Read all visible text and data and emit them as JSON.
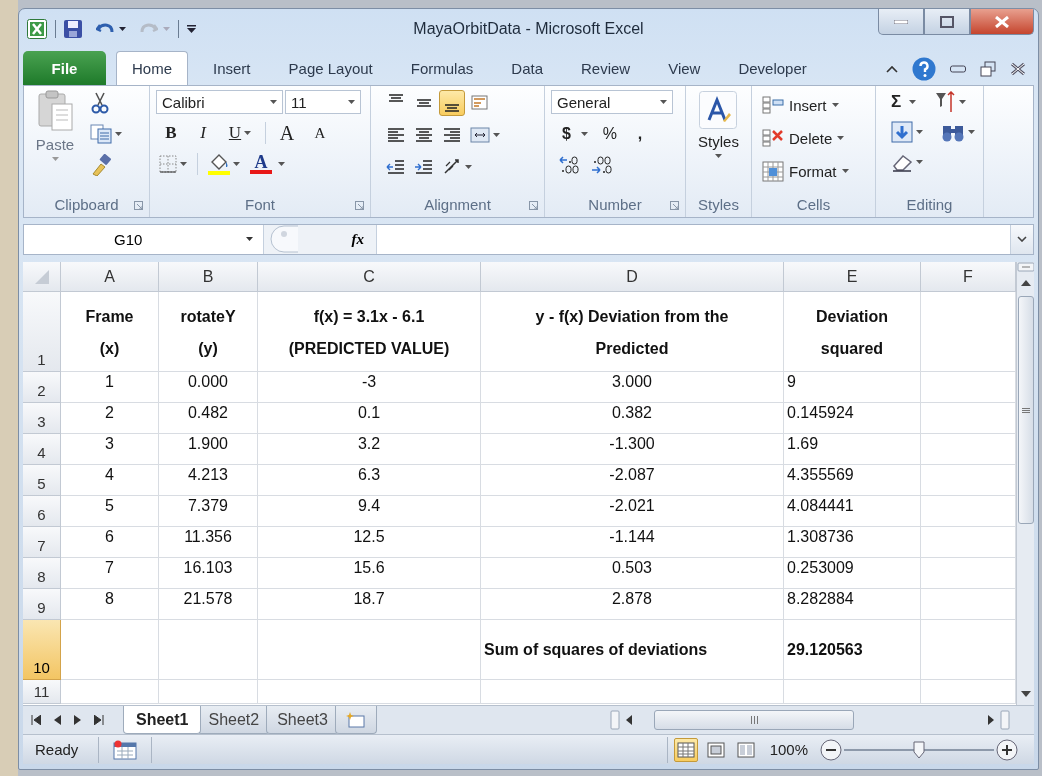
{
  "window": {
    "title": "MayaOrbitData - Microsoft Excel"
  },
  "ribbon_tabs": [
    {
      "label": "File",
      "kind": "file",
      "selected": false
    },
    {
      "label": "Home",
      "kind": "tab",
      "selected": true
    },
    {
      "label": "Insert",
      "kind": "tab",
      "selected": false
    },
    {
      "label": "Page Layout",
      "kind": "tab",
      "selected": false
    },
    {
      "label": "Formulas",
      "kind": "tab",
      "selected": false
    },
    {
      "label": "Data",
      "kind": "tab",
      "selected": false
    },
    {
      "label": "Review",
      "kind": "tab",
      "selected": false
    },
    {
      "label": "View",
      "kind": "tab",
      "selected": false
    },
    {
      "label": "Developer",
      "kind": "tab",
      "selected": false
    }
  ],
  "ribbon": {
    "clipboard": {
      "label": "Clipboard",
      "paste": "Paste"
    },
    "font": {
      "label": "Font",
      "name": "Calibri",
      "size": "11",
      "bold": "B",
      "italic": "I",
      "underline": "U",
      "grow": "A",
      "shrink": "A",
      "color_letter": "A"
    },
    "alignment": {
      "label": "Alignment",
      "buttons": [
        {
          "kind": "top",
          "selected": false
        },
        {
          "kind": "middle",
          "selected": false
        },
        {
          "kind": "bottom",
          "selected": true
        },
        {
          "kind": "wrap",
          "selected": false
        },
        {
          "kind": "left",
          "selected": false
        },
        {
          "kind": "center",
          "selected": false
        },
        {
          "kind": "right",
          "selected": false
        },
        {
          "kind": "merge",
          "selected": false
        },
        {
          "kind": "outdent",
          "selected": false
        },
        {
          "kind": "indent",
          "selected": false
        },
        {
          "kind": "orientation",
          "selected": false
        }
      ]
    },
    "number": {
      "label": "Number",
      "format": "General",
      "currency": "$",
      "percent": "%",
      "comma": ","
    },
    "styles": {
      "button": "Styles",
      "label": "Styles"
    },
    "cells": {
      "label": "Cells",
      "items": [
        "Insert",
        "Delete",
        "Format"
      ]
    },
    "editing": {
      "label": "Editing",
      "sum": "Σ"
    }
  },
  "formula_bar": {
    "name_box": "G10",
    "fx": "fx"
  },
  "sheet": {
    "columns": [
      {
        "label": "A",
        "selected": false
      },
      {
        "label": "B",
        "selected": false
      },
      {
        "label": "C",
        "selected": false
      },
      {
        "label": "D",
        "selected": false
      },
      {
        "label": "E",
        "selected": false
      },
      {
        "label": "F",
        "selected": false
      }
    ],
    "rows": [
      {
        "header": "1",
        "selected": false,
        "kind": "header",
        "cells": [
          "Frame\n(x)",
          "rotateY\n(y)",
          "f(x) = 3.1x - 6.1\n(PREDICTED VALUE)",
          "y - f(x) Deviation from the\nPredicted",
          "Deviation\nsquared"
        ]
      },
      {
        "header": "2",
        "selected": false,
        "kind": "data",
        "cells": [
          "1",
          "0.000",
          "-3",
          "3.000",
          "9"
        ]
      },
      {
        "header": "3",
        "selected": false,
        "kind": "data",
        "cells": [
          "2",
          "0.482",
          "0.1",
          "0.382",
          "0.145924"
        ]
      },
      {
        "header": "4",
        "selected": false,
        "kind": "data",
        "cells": [
          "3",
          "1.900",
          "3.2",
          "-1.300",
          "1.69"
        ]
      },
      {
        "header": "5",
        "selected": false,
        "kind": "data",
        "cells": [
          "4",
          "4.213",
          "6.3",
          "-2.087",
          "4.355569"
        ]
      },
      {
        "header": "6",
        "selected": false,
        "kind": "data",
        "cells": [
          "5",
          "7.379",
          "9.4",
          "-2.021",
          "4.084441"
        ]
      },
      {
        "header": "7",
        "selected": false,
        "kind": "data",
        "cells": [
          "6",
          "11.356",
          "12.5",
          "-1.144",
          "1.308736"
        ]
      },
      {
        "header": "8",
        "selected": false,
        "kind": "data",
        "cells": [
          "7",
          "16.103",
          "15.6",
          "0.503",
          "0.253009"
        ]
      },
      {
        "header": "9",
        "selected": false,
        "kind": "data",
        "cells": [
          "8",
          "21.578",
          "18.7",
          "2.878",
          "8.282884"
        ]
      },
      {
        "header": "10",
        "selected": true,
        "kind": "total",
        "cells": [
          null,
          null,
          null,
          "Sum of squares of deviations",
          "29.120563"
        ]
      },
      {
        "header": "11",
        "selected": false,
        "kind": "data"
      }
    ]
  },
  "sheet_tabs": [
    {
      "label": "Sheet1",
      "selected": true
    },
    {
      "label": "Sheet2",
      "selected": false
    },
    {
      "label": "Sheet3",
      "selected": false
    }
  ],
  "status_bar": {
    "ready": "Ready",
    "view_modes": [
      {
        "kind": "normal",
        "selected": true
      },
      {
        "kind": "page_layout",
        "selected": false
      },
      {
        "kind": "page_break",
        "selected": false
      }
    ],
    "zoom": "100%",
    "zoom_slider": {
      "level": 0.5
    }
  }
}
